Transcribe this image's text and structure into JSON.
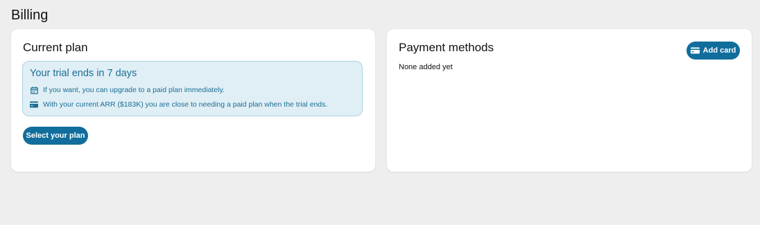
{
  "page": {
    "title": "Billing"
  },
  "current_plan": {
    "title": "Current plan",
    "trial": {
      "heading": "Your trial ends in 7 days",
      "lines": [
        {
          "icon": "calendar-icon",
          "text": "If you want, you can upgrade to a paid plan immediately."
        },
        {
          "icon": "credit-card-icon",
          "text": "With your current ARR ($183K) you are close to needing a paid plan when the trial ends."
        }
      ]
    },
    "select_plan_label": "Select your plan"
  },
  "payment_methods": {
    "title": "Payment methods",
    "add_card_label": "Add card",
    "add_card_icon": "credit-card-icon",
    "empty_text": "None added yet"
  },
  "colors": {
    "background": "#eeeeee",
    "card": "#ffffff",
    "accent": "#116d9c",
    "info_background": "#e0eff5",
    "info_border": "#a9d1e1",
    "info_text": "#1a6d95"
  }
}
